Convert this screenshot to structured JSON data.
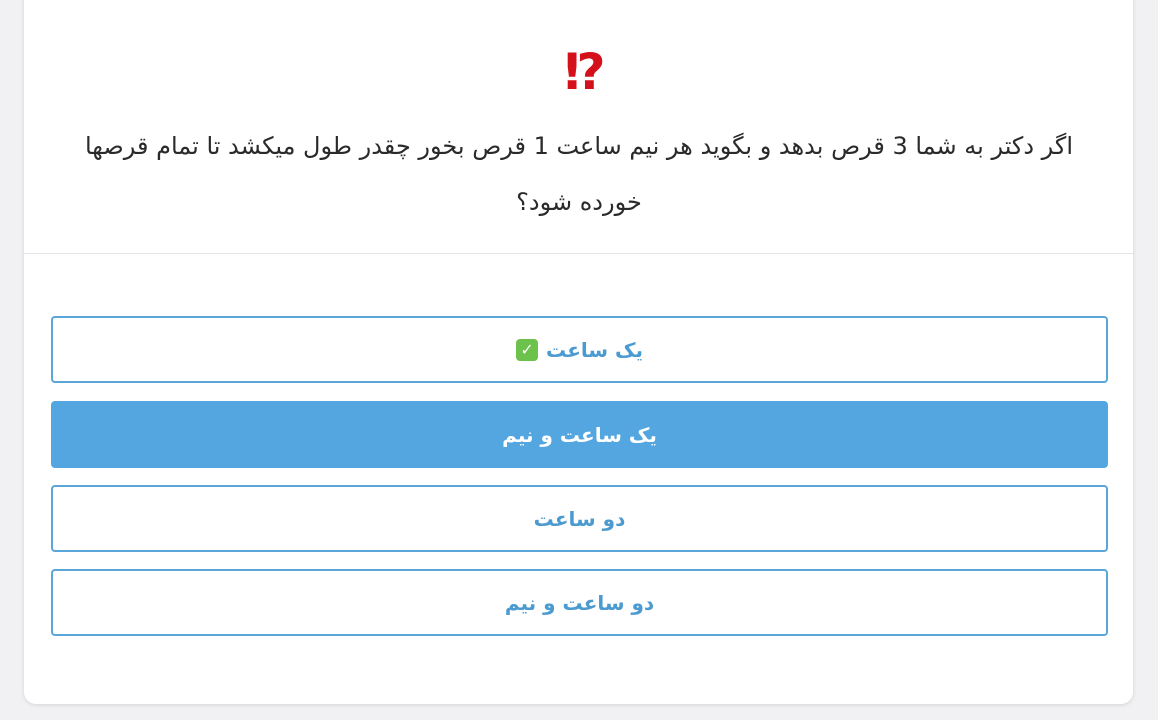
{
  "question": {
    "icon": "exclamation-question-icon",
    "icon_glyph": "⁉",
    "text": "اگر دکتر به شما 3 قرص بدهد و بگوید هر نیم ساعت 1 قرص بخور چقدر طول میکشد تا تمام قرصها خورده شود؟"
  },
  "options": [
    {
      "label": "یک ساعت",
      "correct": true,
      "check_glyph": "✓"
    },
    {
      "label": "یک ساعت و نیم",
      "selected": true
    },
    {
      "label": "دو ساعت"
    },
    {
      "label": "دو ساعت و نیم"
    }
  ],
  "colors": {
    "accent": "#53a6df",
    "option_text": "#4b9ad0",
    "icon_red": "#d4101b",
    "check_green": "#6cc24a"
  }
}
